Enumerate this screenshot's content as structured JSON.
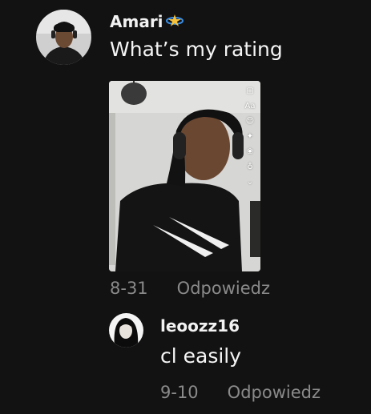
{
  "comments": [
    {
      "username": "Amari",
      "badge_icon": "halo-star-emoji-icon",
      "text": "What’s my rating",
      "date": "8-31",
      "reply_label": "Odpowiedz",
      "photo": {
        "tools": [
          "text-box-icon",
          "Aa",
          "sticker-icon",
          "sparkle-icon",
          "filter-icon",
          "mic-icon",
          "chevron-down-icon"
        ]
      }
    },
    {
      "username": "leoozz16",
      "text": "cl easily",
      "date": "9-10",
      "reply_label": "Odpowiedz"
    }
  ],
  "colors": {
    "background": "#121212",
    "text": "#ffffff",
    "meta": "#8a8a8a"
  }
}
